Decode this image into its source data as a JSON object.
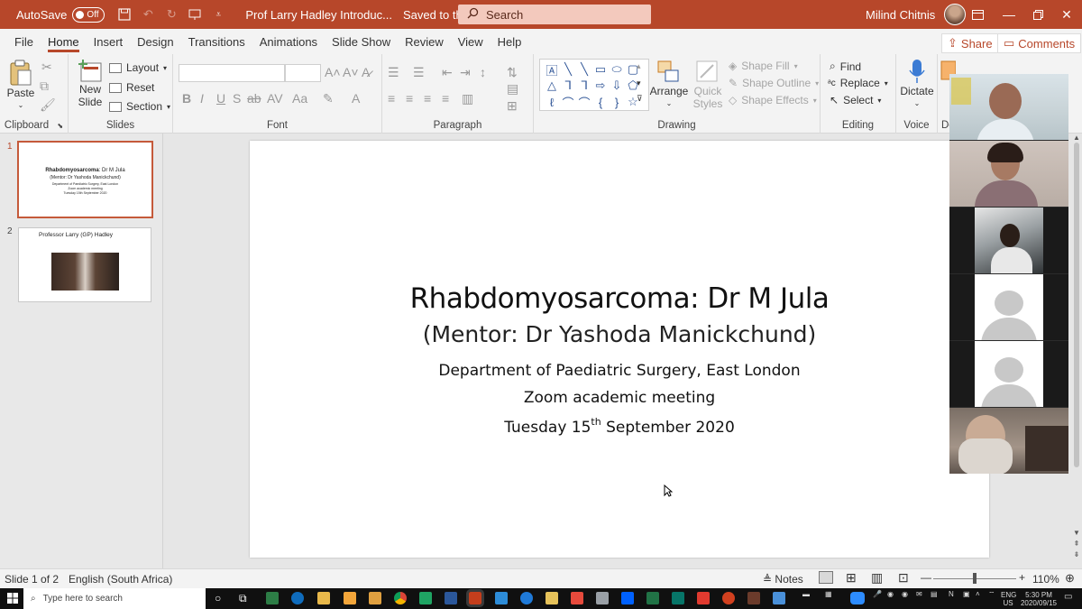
{
  "titlebar": {
    "autosave_label": "AutoSave",
    "autosave_state": "Off",
    "doc_title": "Prof Larry Hadley Introduc...",
    "saved_status": "Saved to this PC",
    "search_placeholder": "Search",
    "user_name": "Milind Chitnis",
    "bg_color": "#b7472a"
  },
  "menu": {
    "tabs": [
      "File",
      "Home",
      "Insert",
      "Design",
      "Transitions",
      "Animations",
      "Slide Show",
      "Review",
      "View",
      "Help"
    ],
    "active": "Home",
    "share_label": "Share",
    "comments_label": "Comments"
  },
  "ribbon": {
    "clipboard": {
      "paste": "Paste",
      "label": "Clipboard"
    },
    "slides": {
      "new_slide_1": "New",
      "new_slide_2": "Slide",
      "layout": "Layout",
      "reset": "Reset",
      "section": "Section",
      "label": "Slides"
    },
    "font": {
      "label": "Font"
    },
    "paragraph": {
      "label": "Paragraph"
    },
    "drawing": {
      "arrange": "Arrange",
      "quick_styles_1": "Quick",
      "quick_styles_2": "Styles",
      "shape_fill": "Shape Fill",
      "shape_outline": "Shape Outline",
      "shape_effects": "Shape Effects",
      "label": "Drawing"
    },
    "editing": {
      "find": "Find",
      "replace": "Replace",
      "select": "Select",
      "label": "Editing"
    },
    "voice": {
      "dictate": "Dictate",
      "label": "Voice"
    },
    "designer_partial": "De"
  },
  "thumbnails": [
    {
      "number": "1",
      "title_bold": "Rhabdomyosarcoma",
      "title_rest": ": Dr M Jula",
      "mentor": "(Mentor: Dr Yashoda Manickchund)",
      "line1": "Department of Paediatric Surgery, East London",
      "line2": "Zoom academic meeting",
      "line3": "Tuesday 15th September 2020"
    },
    {
      "number": "2",
      "title": "Professor Larry (GP) Hadley"
    }
  ],
  "slide": {
    "title_bold": "Rhabdomyosarcoma",
    "title_rest": ": Dr M Jula",
    "subtitle": "(Mentor: Dr Yashoda Manickchund)",
    "line1": "Department of Paediatric Surgery, East London",
    "line2": "Zoom academic meeting",
    "line3_pre": "Tuesday 15",
    "line3_sup": "th",
    "line3_post": " September 2020"
  },
  "status": {
    "slide_count": "Slide 1 of 2",
    "language": "English (South Africa)",
    "notes": "Notes",
    "zoom": "110%"
  },
  "taskbar": {
    "search_placeholder": "Type here to search",
    "lang_1": "ENG",
    "lang_2": "US",
    "time": "5:30 PM",
    "date": "2020/09/15"
  }
}
